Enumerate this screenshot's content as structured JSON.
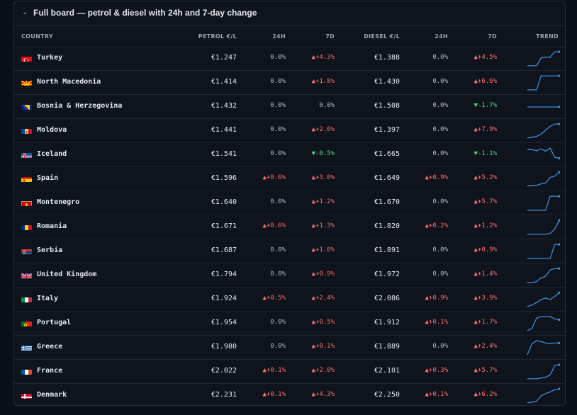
{
  "panel": {
    "collapse_glyph": "-",
    "title": "Full board — petrol & diesel with 24h and 7-day change"
  },
  "columns": {
    "country": "COUNTRY",
    "petrol": "PETROL €/L",
    "p24": "24H",
    "p7": "7D",
    "diesel": "DIESEL €/L",
    "d24": "24H",
    "d7": "7D",
    "trend": "TREND"
  },
  "colors": {
    "up": "#ff6f6f",
    "down": "#4ade80",
    "spark": "#3f8fd8"
  },
  "rows": [
    {
      "country": "Turkey",
      "flag": "flag-turkey-icon",
      "petrol": "€1.247",
      "p24": "0.0%",
      "p7": "▲+4.3%",
      "diesel": "€1.388",
      "d24": "0.0%",
      "d7": "▲+4.5%",
      "trend_pct": [
        0.05,
        0.05,
        0.05,
        0.55,
        0.6,
        0.6,
        0.95,
        0.95
      ]
    },
    {
      "country": "North Macedonia",
      "flag": "flag-north-macedonia-icon",
      "petrol": "€1.414",
      "p24": "0.0%",
      "p7": "▲+1.8%",
      "diesel": "€1.430",
      "d24": "0.0%",
      "d7": "▲+6.6%",
      "trend_pct": [
        0.05,
        0.05,
        0.05,
        0.95,
        0.95,
        0.95,
        0.95,
        0.95
      ]
    },
    {
      "country": "Bosnia & Herzegovina",
      "flag": "flag-bosnia-icon",
      "petrol": "€1.432",
      "p24": "0.0%",
      "p7": "0.0%",
      "diesel": "€1.508",
      "d24": "0.0%",
      "d7": "▼-1.7%",
      "trend_pct": [
        0.5,
        0.5,
        0.5,
        0.5,
        0.5,
        0.5,
        0.5,
        0.5
      ]
    },
    {
      "country": "Moldova",
      "flag": "flag-moldova-icon",
      "petrol": "€1.441",
      "p24": "0.0%",
      "p7": "▲+2.6%",
      "diesel": "€1.397",
      "d24": "0.0%",
      "d7": "▲+7.9%",
      "trend_pct": [
        0.05,
        0.1,
        0.15,
        0.3,
        0.55,
        0.8,
        0.95,
        0.95
      ]
    },
    {
      "country": "Iceland",
      "flag": "flag-iceland-icon",
      "petrol": "€1.541",
      "p24": "0.0%",
      "p7": "▼-0.5%",
      "diesel": "€1.665",
      "d24": "0.0%",
      "d7": "▼-1.1%",
      "trend_pct": [
        0.85,
        0.85,
        0.78,
        0.9,
        0.75,
        0.95,
        0.35,
        0.3
      ]
    },
    {
      "country": "Spain",
      "flag": "flag-spain-icon",
      "petrol": "€1.596",
      "p24": "▲+0.6%",
      "p7": "▲+3.0%",
      "diesel": "€1.649",
      "d24": "▲+0.9%",
      "d7": "▲+5.2%",
      "trend_pct": [
        0.05,
        0.1,
        0.1,
        0.2,
        0.25,
        0.6,
        0.7,
        0.95
      ]
    },
    {
      "country": "Montenegro",
      "flag": "flag-montenegro-icon",
      "petrol": "€1.640",
      "p24": "0.0%",
      "p7": "▲+1.2%",
      "diesel": "€1.670",
      "d24": "0.0%",
      "d7": "▲+5.7%",
      "trend_pct": [
        0.05,
        0.05,
        0.05,
        0.05,
        0.05,
        0.95,
        0.95,
        0.95
      ]
    },
    {
      "country": "Romania",
      "flag": "flag-romania-icon",
      "petrol": "€1.671",
      "p24": "▲+0.6%",
      "p7": "▲+1.3%",
      "diesel": "€1.820",
      "d24": "▲+0.2%",
      "d7": "▲+1.2%",
      "trend_pct": [
        0.05,
        0.05,
        0.05,
        0.05,
        0.05,
        0.1,
        0.4,
        0.95
      ]
    },
    {
      "country": "Serbia",
      "flag": "flag-serbia-icon",
      "petrol": "€1.687",
      "p24": "0.0%",
      "p7": "▲+1.0%",
      "diesel": "€1.891",
      "d24": "0.0%",
      "d7": "▲+0.9%",
      "trend_pct": [
        0.05,
        0.05,
        0.05,
        0.05,
        0.05,
        0.05,
        0.95,
        0.95
      ]
    },
    {
      "country": "United Kingdom",
      "flag": "flag-uk-icon",
      "petrol": "€1.794",
      "p24": "0.0%",
      "p7": "▲+0.9%",
      "diesel": "€1.972",
      "d24": "0.0%",
      "d7": "▲+1.4%",
      "trend_pct": [
        0.05,
        0.05,
        0.1,
        0.35,
        0.45,
        0.85,
        0.95,
        0.95
      ]
    },
    {
      "country": "Italy",
      "flag": "flag-italy-icon",
      "petrol": "€1.924",
      "p24": "▲+0.5%",
      "p7": "▲+2.4%",
      "diesel": "€2.086",
      "d24": "▲+0.9%",
      "d7": "▲+3.9%",
      "trend_pct": [
        0.05,
        0.15,
        0.3,
        0.5,
        0.6,
        0.5,
        0.7,
        0.95
      ]
    },
    {
      "country": "Portugal",
      "flag": "flag-portugal-icon",
      "petrol": "€1.954",
      "p24": "0.0%",
      "p7": "▲+0.5%",
      "diesel": "€1.912",
      "d24": "▲+0.1%",
      "d7": "▲+1.7%",
      "trend_pct": [
        0.05,
        0.2,
        0.85,
        0.95,
        0.95,
        0.95,
        0.8,
        0.75
      ]
    },
    {
      "country": "Greece",
      "flag": "flag-greece-icon",
      "petrol": "€1.980",
      "p24": "0.0%",
      "p7": "▲+0.1%",
      "diesel": "€1.889",
      "d24": "0.0%",
      "d7": "▲+2.4%",
      "trend_pct": [
        0.05,
        0.75,
        0.95,
        0.9,
        0.8,
        0.78,
        0.8,
        0.8
      ]
    },
    {
      "country": "France",
      "flag": "flag-france-icon",
      "petrol": "€2.022",
      "p24": "▲+0.1%",
      "p7": "▲+2.0%",
      "diesel": "€2.101",
      "d24": "▲+0.3%",
      "d7": "▲+5.7%",
      "trend_pct": [
        0.05,
        0.05,
        0.05,
        0.1,
        0.15,
        0.3,
        0.9,
        0.95
      ]
    },
    {
      "country": "Denmark",
      "flag": "flag-denmark-icon",
      "petrol": "€2.231",
      "p24": "▲+0.1%",
      "p7": "▲+4.3%",
      "diesel": "€2.250",
      "d24": "▲+0.1%",
      "d7": "▲+6.2%",
      "trend_pct": [
        0.05,
        0.1,
        0.15,
        0.5,
        0.65,
        0.75,
        0.9,
        0.95
      ]
    }
  ]
}
